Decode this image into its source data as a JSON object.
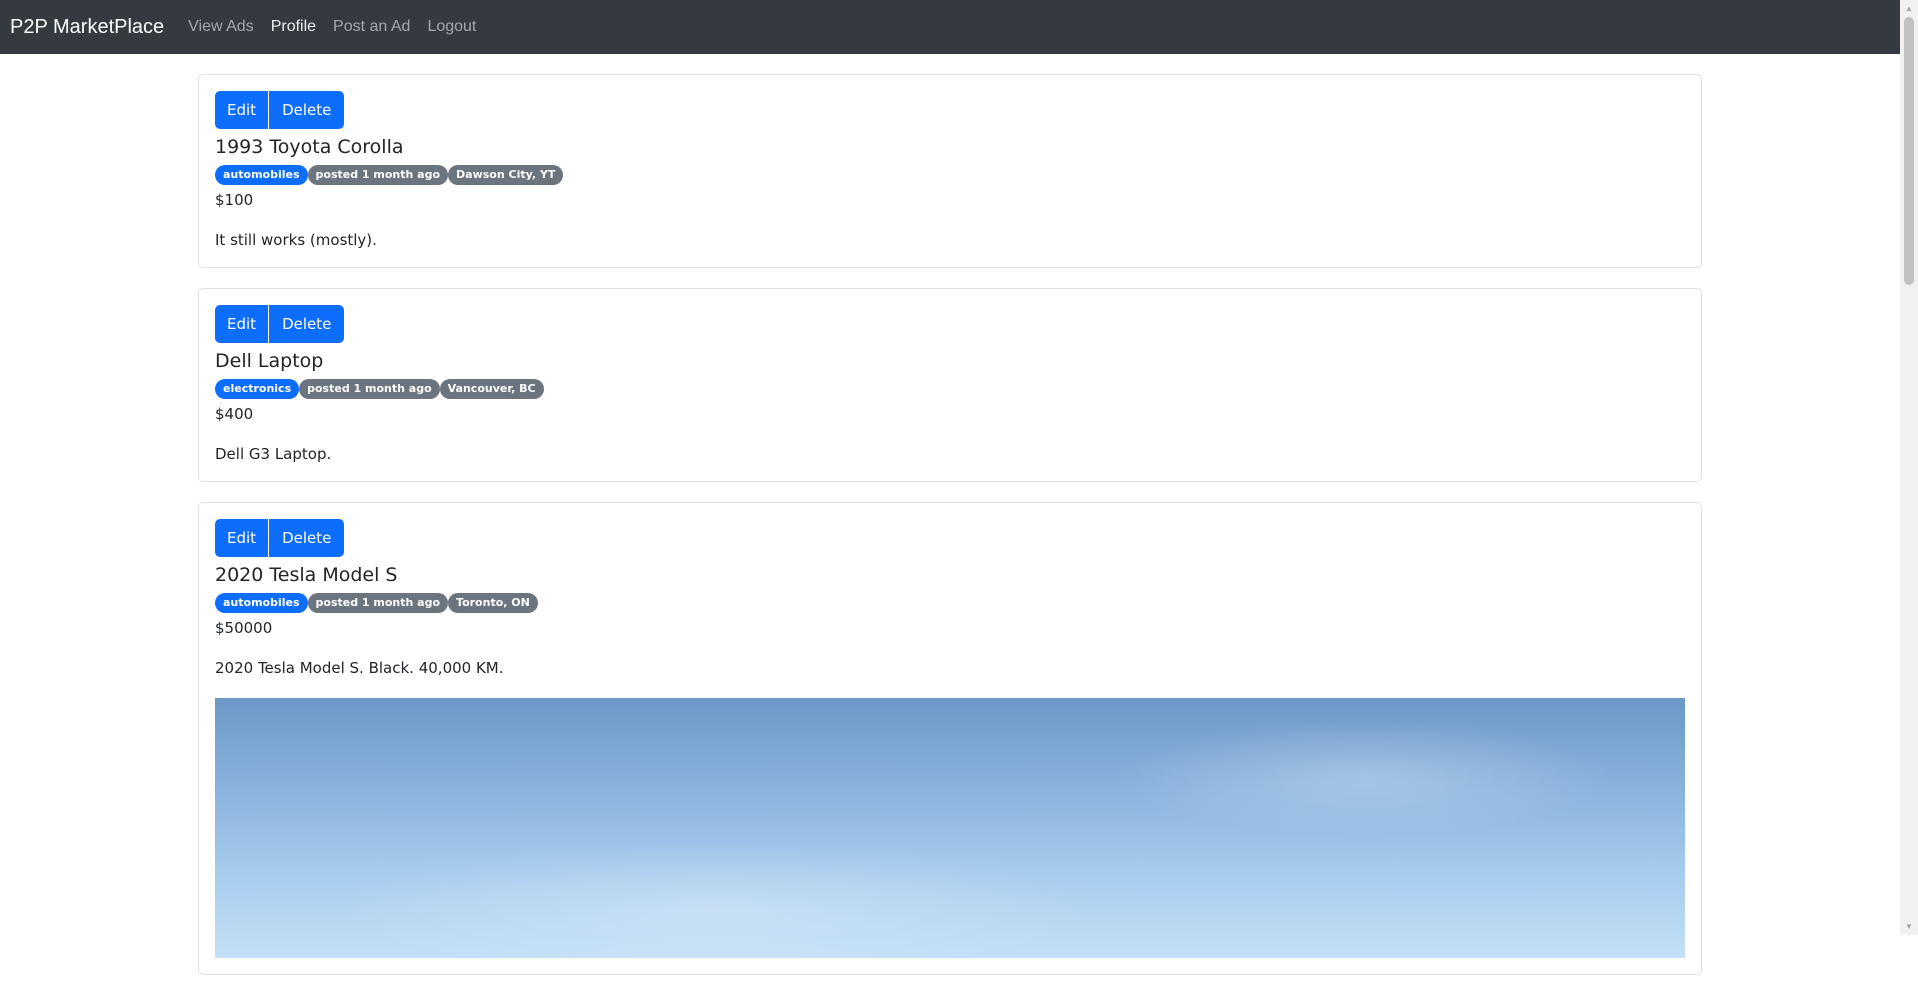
{
  "navbar": {
    "brand": "P2P MarketPlace",
    "links": [
      {
        "label": "View Ads"
      },
      {
        "label": "Profile"
      },
      {
        "label": "Post an Ad"
      },
      {
        "label": "Logout"
      }
    ],
    "background": "#343a40"
  },
  "colors": {
    "primary": "#0d6efd",
    "secondary": "#6c757d"
  },
  "actions": {
    "edit_label": "Edit",
    "delete_label": "Delete"
  },
  "ads": [
    {
      "title": "1993 Toyota Corolla",
      "category": "automobiles",
      "posted": "posted 1 month ago",
      "location": "Dawson City, YT",
      "price": "$100",
      "description": "It still works (mostly)."
    },
    {
      "title": "Dell Laptop",
      "category": "electronics",
      "posted": "posted 1 month ago",
      "location": "Vancouver, BC",
      "price": "$400",
      "description": "Dell G3 Laptop."
    },
    {
      "title": "2020 Tesla Model S",
      "category": "automobiles",
      "posted": "posted 1 month ago",
      "location": "Toronto, ON",
      "price": "$50000",
      "description": "2020 Tesla Model S. Black. 40,000 KM."
    }
  ]
}
